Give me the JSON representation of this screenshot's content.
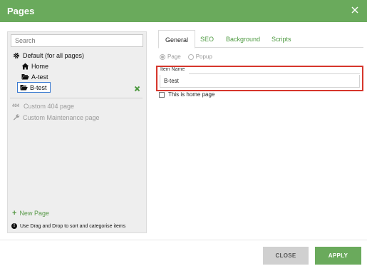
{
  "window": {
    "title": "Pages"
  },
  "sidebar": {
    "search_placeholder": "Search",
    "tree": {
      "root": "Default (for all pages)",
      "home": "Home",
      "a_test": "A-test",
      "b_test": "B-test"
    },
    "special": {
      "not_found_badge": "404",
      "not_found": "Custom 404 page",
      "maintenance": "Custom Maintenance page"
    },
    "new_page": "New Page",
    "hint": "Use Drag and Drop to sort and categorise items"
  },
  "tabs": [
    "General",
    "SEO",
    "Background",
    "Scripts"
  ],
  "general": {
    "type_options": [
      "Page",
      "Popup"
    ],
    "item_name_label": "Item Name",
    "item_name_value": "B-test",
    "home_checkbox": "This is home page"
  },
  "footer": {
    "close": "CLOSE",
    "apply": "APPLY"
  },
  "colors": {
    "brand": "#6aaa5c",
    "highlight": "#d6362c",
    "selection": "#3a7ad0"
  }
}
